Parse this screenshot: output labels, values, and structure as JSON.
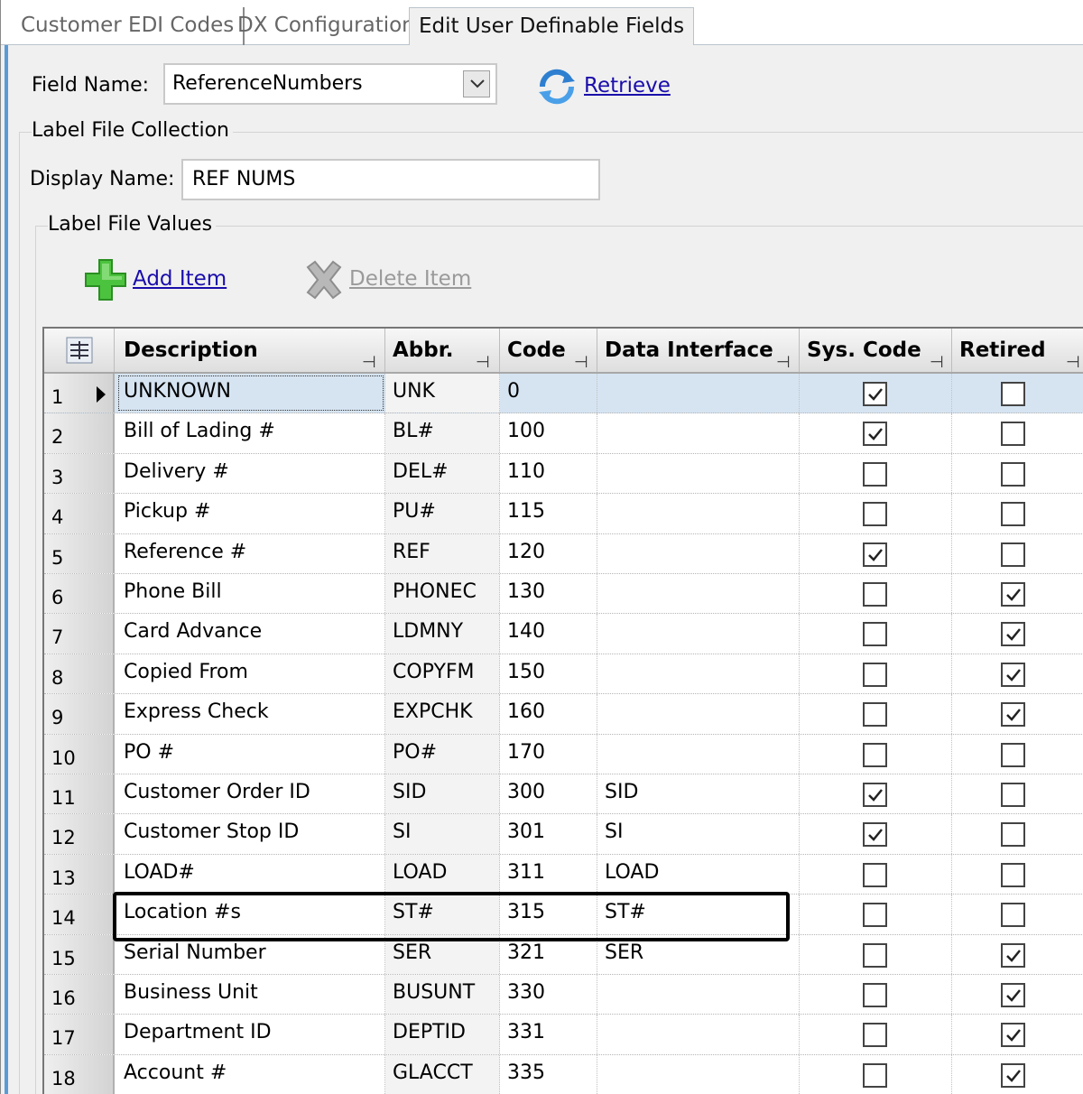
{
  "tabs": [
    "Customer EDI Codes",
    "DX Configuration",
    "Edit User Definable Fields"
  ],
  "field_name": {
    "label": "Field Name:",
    "value": "ReferenceNumbers"
  },
  "retrieve_label": "Retrieve",
  "label_file_collection": "Label File Collection",
  "display_name": {
    "label": "Display Name:",
    "value": "REF NUMS"
  },
  "label_file_values": "Label File Values",
  "add_item": "Add Item",
  "delete_item": "Delete Item",
  "columns": [
    "Description",
    "Abbr.",
    "Code",
    "Data Interface",
    "Sys. Code",
    "Retired"
  ],
  "rows": [
    {
      "n": "1",
      "desc": "UNKNOWN",
      "abbr": "UNK",
      "code": "0",
      "di": "",
      "sys": true,
      "retired": false
    },
    {
      "n": "2",
      "desc": "Bill of Lading #",
      "abbr": "BL#",
      "code": "100",
      "di": "",
      "sys": true,
      "retired": false
    },
    {
      "n": "3",
      "desc": "Delivery #",
      "abbr": "DEL#",
      "code": "110",
      "di": "",
      "sys": false,
      "retired": false
    },
    {
      "n": "4",
      "desc": "Pickup #",
      "abbr": "PU#",
      "code": "115",
      "di": "",
      "sys": false,
      "retired": false
    },
    {
      "n": "5",
      "desc": "Reference #",
      "abbr": "REF",
      "code": "120",
      "di": "",
      "sys": true,
      "retired": false
    },
    {
      "n": "6",
      "desc": "Phone Bill",
      "abbr": "PHONEC",
      "code": "130",
      "di": "",
      "sys": false,
      "retired": true
    },
    {
      "n": "7",
      "desc": "Card Advance",
      "abbr": "LDMNY",
      "code": "140",
      "di": "",
      "sys": false,
      "retired": true
    },
    {
      "n": "8",
      "desc": "Copied From",
      "abbr": "COPYFM",
      "code": "150",
      "di": "",
      "sys": false,
      "retired": true
    },
    {
      "n": "9",
      "desc": "Express Check",
      "abbr": "EXPCHK",
      "code": "160",
      "di": "",
      "sys": false,
      "retired": true
    },
    {
      "n": "10",
      "desc": "PO #",
      "abbr": "PO#",
      "code": "170",
      "di": "",
      "sys": false,
      "retired": false
    },
    {
      "n": "11",
      "desc": "Customer Order ID",
      "abbr": "SID",
      "code": "300",
      "di": "SID",
      "sys": true,
      "retired": false
    },
    {
      "n": "12",
      "desc": "Customer Stop ID",
      "abbr": "SI",
      "code": "301",
      "di": "SI",
      "sys": true,
      "retired": false
    },
    {
      "n": "13",
      "desc": "LOAD#",
      "abbr": "LOAD",
      "code": "311",
      "di": "LOAD",
      "sys": false,
      "retired": false
    },
    {
      "n": "14",
      "desc": "Location #s",
      "abbr": "ST#",
      "code": "315",
      "di": "ST#",
      "sys": false,
      "retired": false
    },
    {
      "n": "15",
      "desc": "Serial Number",
      "abbr": "SER",
      "code": "321",
      "di": "SER",
      "sys": false,
      "retired": true
    },
    {
      "n": "16",
      "desc": "Business Unit",
      "abbr": "BUSUNT",
      "code": "330",
      "di": "",
      "sys": false,
      "retired": true
    },
    {
      "n": "17",
      "desc": "Department ID",
      "abbr": "DEPTID",
      "code": "331",
      "di": "",
      "sys": false,
      "retired": true
    },
    {
      "n": "18",
      "desc": "Account #",
      "abbr": "GLACCT",
      "code": "335",
      "di": "",
      "sys": false,
      "retired": true
    }
  ],
  "selected_row": "1",
  "highlighted_row": "14"
}
